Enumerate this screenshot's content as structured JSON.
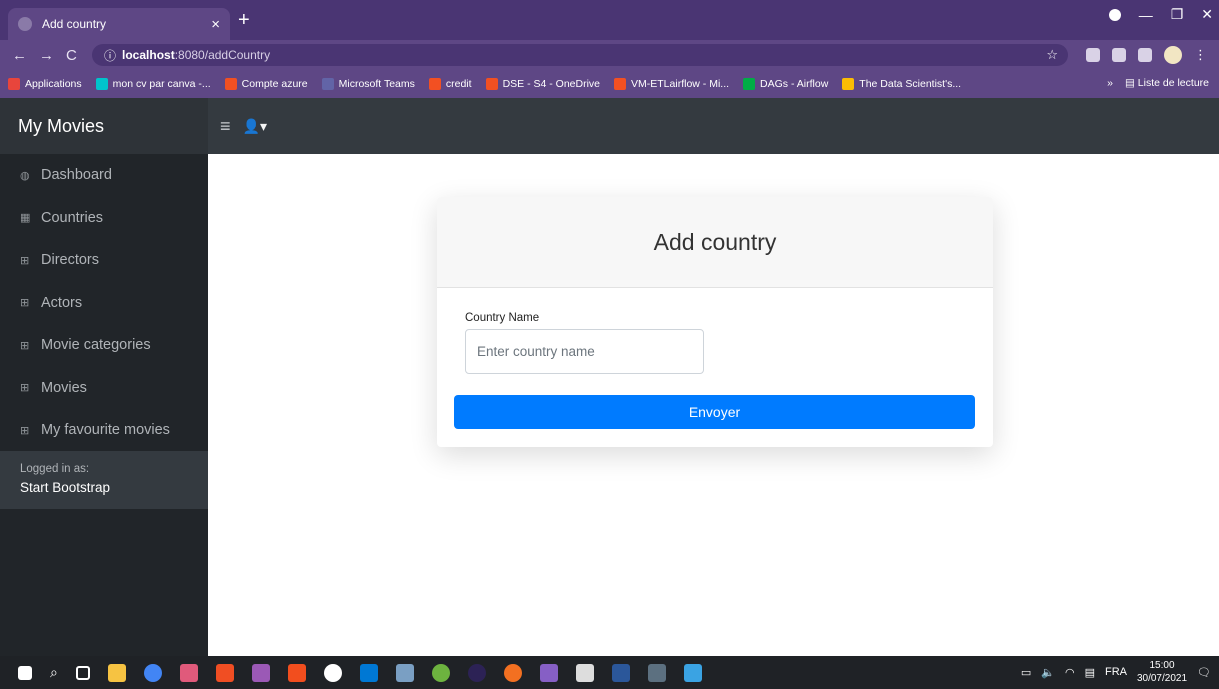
{
  "browser": {
    "tab_title": "Add country",
    "tab_close": "×",
    "new_tab": "+",
    "url_host": "localhost",
    "url_path": ":8080/addCountry",
    "bookmarks": [
      {
        "label": "Applications",
        "color": "#e8453c"
      },
      {
        "label": "mon cv par canva -...",
        "color": "#00c4cc"
      },
      {
        "label": "Compte azure",
        "color": "#f25022"
      },
      {
        "label": "Microsoft Teams",
        "color": "#6264a7"
      },
      {
        "label": "credit",
        "color": "#f25022"
      },
      {
        "label": "DSE - S4 - OneDrive",
        "color": "#f25022"
      },
      {
        "label": "VM-ETLairflow - Mi...",
        "color": "#f25022"
      },
      {
        "label": "DAGs - Airflow",
        "color": "#00ad46"
      },
      {
        "label": "The Data Scientist's...",
        "color": "#fbbc04"
      }
    ],
    "reading_list": "Liste de lecture",
    "overflow": "»"
  },
  "app": {
    "brand": "My Movies",
    "sidebar": {
      "items": [
        {
          "label": "Dashboard",
          "icon": "tachometer-icon",
          "glyph": "◍"
        },
        {
          "label": "Countries",
          "icon": "chart-area-icon",
          "glyph": "▦"
        },
        {
          "label": "Directors",
          "icon": "table-icon",
          "glyph": "⊞"
        },
        {
          "label": "Actors",
          "icon": "table-icon",
          "glyph": "⊞"
        },
        {
          "label": "Movie categories",
          "icon": "table-icon",
          "glyph": "⊞"
        },
        {
          "label": "Movies",
          "icon": "table-icon",
          "glyph": "⊞"
        },
        {
          "label": "My favourite movies",
          "icon": "table-icon",
          "glyph": "⊞"
        }
      ],
      "logged_in_label": "Logged in as:",
      "logged_in_user": "Start Bootstrap"
    },
    "card": {
      "title": "Add country",
      "field_label": "Country Name",
      "field_placeholder": "Enter country name",
      "field_value": "",
      "submit_label": "Envoyer"
    }
  },
  "taskbar": {
    "language": "FRA",
    "time": "15:00",
    "date": "30/07/2021"
  },
  "colors": {
    "primary": "#007bff",
    "sidebar_bg": "#212529",
    "nav_bg": "#343a40",
    "browser_bg": "#5e4785"
  }
}
